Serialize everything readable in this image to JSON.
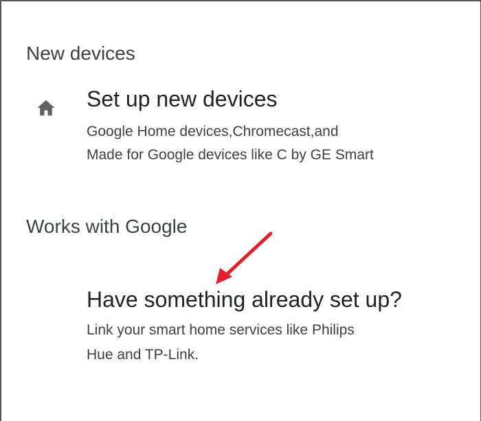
{
  "sections": {
    "new_devices": {
      "header": "New devices",
      "item": {
        "icon": "home-icon",
        "title": "Set up new devices",
        "desc_line1": "Google Home devices,Chromecast,and",
        "desc_line2": "Made for Google devices like C by GE Smart"
      }
    },
    "works_with_google": {
      "header": "Works with Google",
      "item": {
        "title": "Have something already set up?",
        "desc_line1": "Link your smart home services like Philips",
        "desc_line2": "Hue and TP-Link."
      }
    }
  },
  "annotation": {
    "arrow_color": "#e0202a"
  },
  "colors": {
    "icon": "#5f6368",
    "border": "#555555"
  }
}
